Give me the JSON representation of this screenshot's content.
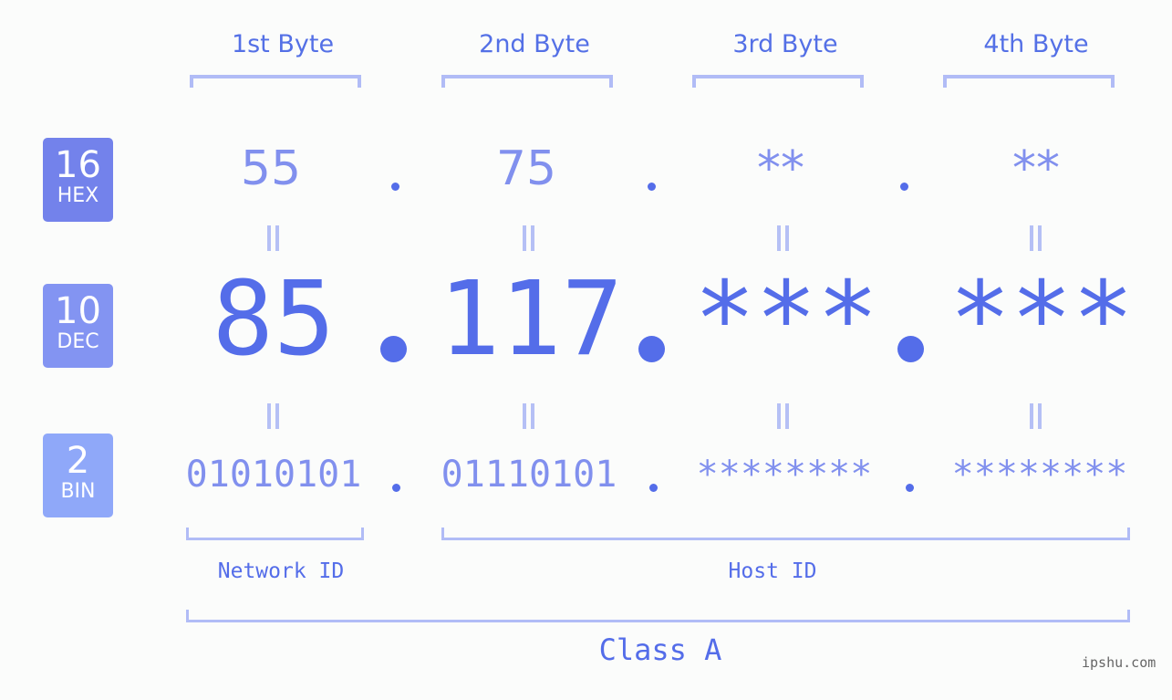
{
  "bytes": [
    {
      "label": "1st Byte",
      "hex": "55",
      "dec": "85",
      "bin": "01010101"
    },
    {
      "label": "2nd Byte",
      "hex": "75",
      "dec": "117",
      "bin": "01110101"
    },
    {
      "label": "3rd Byte",
      "hex": "**",
      "dec": "***",
      "bin": "********"
    },
    {
      "label": "4th Byte",
      "hex": "**",
      "dec": "***",
      "bin": "********"
    }
  ],
  "badges": {
    "hex": {
      "num": "16",
      "label": "HEX",
      "color": "#7382eb"
    },
    "dec": {
      "num": "10",
      "label": "DEC",
      "color": "#8394f2"
    },
    "bin": {
      "num": "2",
      "label": "BIN",
      "color": "#8fa8f9"
    }
  },
  "segments": {
    "network": "Network ID",
    "host": "Host ID",
    "class": "Class A"
  },
  "watermark": "ipshu.com",
  "colors": {
    "accent": "#546de9",
    "light_accent": "#8190ee",
    "bracket": "#b1bcf6"
  }
}
